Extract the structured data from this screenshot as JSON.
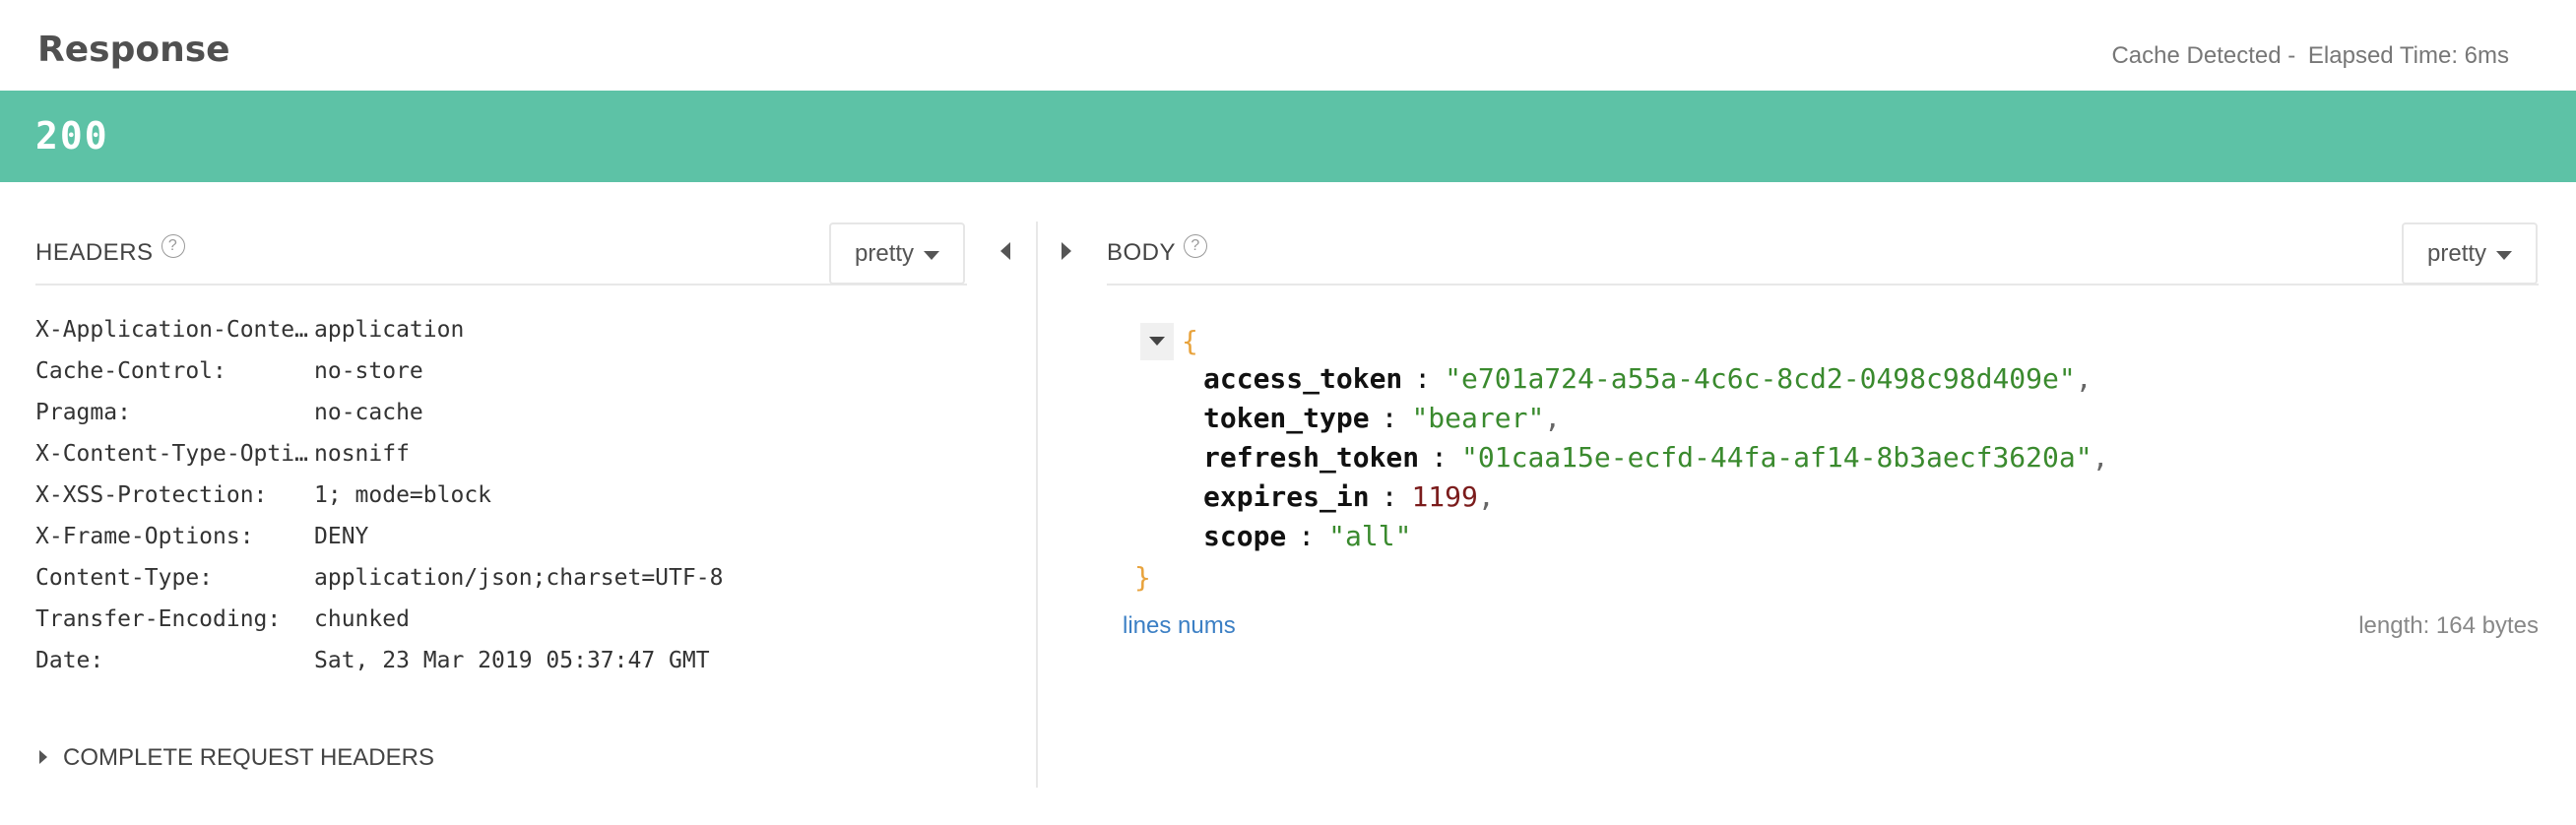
{
  "header": {
    "title": "Response",
    "cache_text": "Cache Detected -",
    "elapsed_text": "Elapsed Time: 6ms"
  },
  "status": {
    "code": "200",
    "color": "#5dc2a6"
  },
  "headers_panel": {
    "title": "HEADERS",
    "help_icon": "?",
    "format_label": "pretty",
    "rows": [
      {
        "name": "X-Application-Context:",
        "value": "application"
      },
      {
        "name": "Cache-Control:",
        "value": "no-store"
      },
      {
        "name": "Pragma:",
        "value": "no-cache"
      },
      {
        "name": "X-Content-Type-Options:",
        "value": "nosniff"
      },
      {
        "name": "X-XSS-Protection:",
        "value": "1; mode=block"
      },
      {
        "name": "X-Frame-Options:",
        "value": "DENY"
      },
      {
        "name": "Content-Type:",
        "value": "application/json;charset=UTF-8"
      },
      {
        "name": "Transfer-Encoding:",
        "value": "chunked"
      },
      {
        "name": "Date:",
        "value": "Sat, 23 Mar 2019 05:37:47 GMT"
      }
    ],
    "complete_request_label": "COMPLETE REQUEST HEADERS"
  },
  "body_panel": {
    "title": "BODY",
    "help_icon": "?",
    "format_label": "pretty",
    "brace_open": "{",
    "brace_close": "}",
    "fields": [
      {
        "key": "access_token",
        "value": "\"e701a724-a55a-4c6c-8cd2-0498c98d409e\"",
        "type": "string",
        "comma": ","
      },
      {
        "key": "token_type",
        "value": "\"bearer\"",
        "type": "string",
        "comma": ","
      },
      {
        "key": "refresh_token",
        "value": "\"01caa15e-ecfd-44fa-af14-8b3aecf3620a\"",
        "type": "string",
        "comma": ","
      },
      {
        "key": "expires_in",
        "value": "1199",
        "type": "number",
        "comma": ","
      },
      {
        "key": "scope",
        "value": "\"all\"",
        "type": "string",
        "comma": ""
      }
    ],
    "lines_nums_label": "lines nums",
    "length_label": "length: 164 bytes"
  }
}
